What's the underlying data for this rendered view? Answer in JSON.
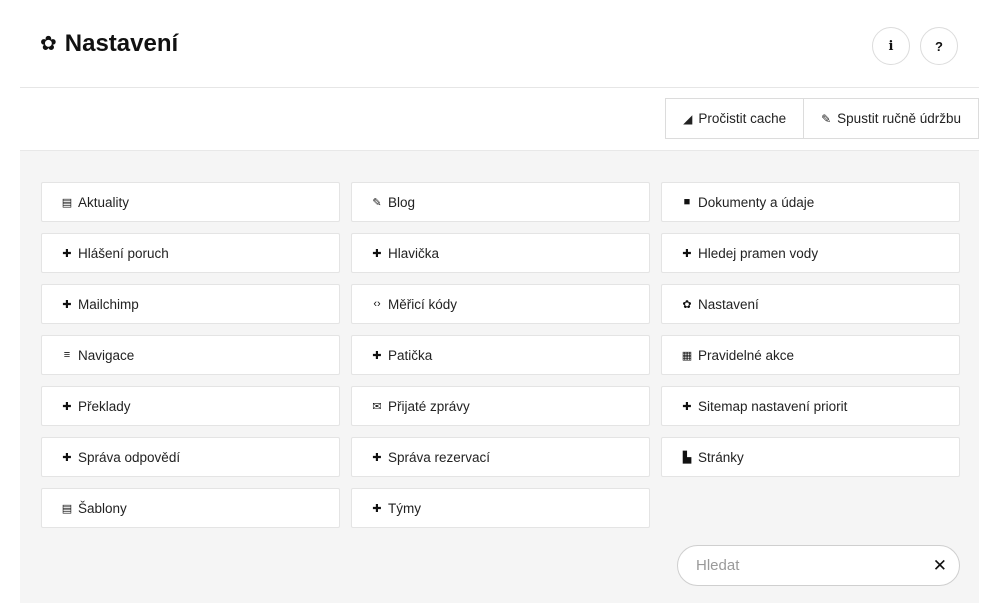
{
  "header": {
    "title": "Nastavení",
    "title_icon": "gear-icon",
    "info_label": "i",
    "help_label": "?"
  },
  "toolbar": {
    "clear_cache_label": "Pročistit cache",
    "maintenance_label": "Spustit ručně údržbu"
  },
  "items": [
    {
      "label": "Aktuality",
      "icon": "newspaper-icon"
    },
    {
      "label": "Blog",
      "icon": "pencil-icon"
    },
    {
      "label": "Dokumenty a údaje",
      "icon": "lock-icon"
    },
    {
      "label": "Hlášení poruch",
      "icon": "puzzle-icon"
    },
    {
      "label": "Hlavička",
      "icon": "puzzle-icon"
    },
    {
      "label": "Hledej pramen vody",
      "icon": "puzzle-icon"
    },
    {
      "label": "Mailchimp",
      "icon": "puzzle-icon"
    },
    {
      "label": "Měřicí kódy",
      "icon": "code-icon"
    },
    {
      "label": "Nastavení",
      "icon": "gear-icon"
    },
    {
      "label": "Navigace",
      "icon": "menu-icon"
    },
    {
      "label": "Patička",
      "icon": "puzzle-icon"
    },
    {
      "label": "Pravidelné akce",
      "icon": "calendar-icon"
    },
    {
      "label": "Překlady",
      "icon": "puzzle-icon"
    },
    {
      "label": "Přijaté zprávy",
      "icon": "envelope-icon"
    },
    {
      "label": "Sitemap nastavení priorit",
      "icon": "puzzle-icon"
    },
    {
      "label": "Správa odpovědí",
      "icon": "puzzle-icon"
    },
    {
      "label": "Správa rezervací",
      "icon": "puzzle-icon"
    },
    {
      "label": "Stránky",
      "icon": "file-icon"
    },
    {
      "label": "Šablony",
      "icon": "file-text-icon"
    },
    {
      "label": "Týmy",
      "icon": "puzzle-icon"
    }
  ],
  "search": {
    "placeholder": "Hledat",
    "value": ""
  }
}
